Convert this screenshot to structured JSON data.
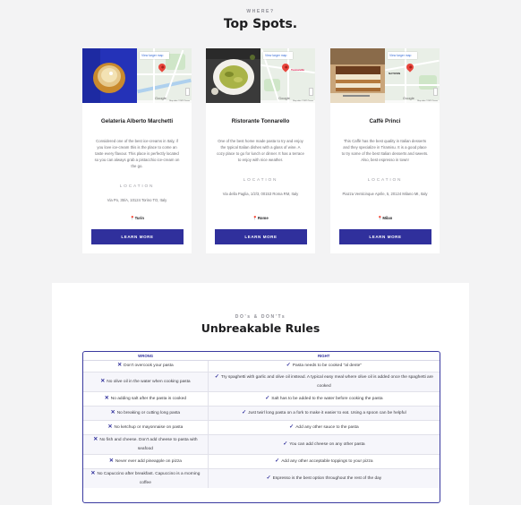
{
  "top_spots": {
    "eyebrow": "WHERE?",
    "title": "Top Spots.",
    "cards": [
      {
        "title": "Gelateria Alberto Marchetti",
        "desc": "Considered one of the best ice-creams in Italy, if you love ice-cream this is the place to come an taste every flavour. This place is perfectly located so you can always grab a pistacchio ice-cream on the go.",
        "location_label": "LOCATION",
        "address": "Via Po, 35/A, 10124 Torino TO, Italy",
        "city": "Turin",
        "button": "LEARN MORE",
        "map_link": "View larger map",
        "map_footer": "Map data ©2025  Terms",
        "map_brand": "Google"
      },
      {
        "title": "Ristorante Tonnarello",
        "desc": "One of the best home made pasta to try and enjoy the typical Italian dishes with a glass of wine. A cozy place to go for lunch or dinner. It has a terrace to enjoy with nice weather.",
        "location_label": "LOCATION",
        "address": "Via della Paglia, 1/2/3, 00153 Roma RM, Italy",
        "city": "Rome",
        "button": "LEARN MORE",
        "map_link": "View larger map",
        "map_footer": "Map data ©2025  Terms",
        "map_brand": "Google",
        "map_place": "Tonnarello"
      },
      {
        "title": "Caffè Princi",
        "desc": "This Caffè has the best quality in Italian desserts and they specialize in Tiramisu. It is a good place to try some of the best Italian desserts and sweets. Also, best espresso in town!",
        "location_label": "LOCATION",
        "address": "Piazza Venticinque Aprile, 5, 20124 Milano MI, Italy",
        "city": "Milan",
        "button": "LEARN MORE",
        "map_link": "View larger map",
        "map_footer": "Map data ©2025  Terms",
        "map_brand": "Google",
        "map_place": "NATOWN"
      }
    ]
  },
  "rules": {
    "eyebrow": "DO's & DON'Ts",
    "title": "Unbreakable Rules",
    "col_wrong": "WRONG",
    "col_right": "RIGHT",
    "rows": [
      {
        "wrong": "Don't overcook your pasta",
        "right": "Pasta needs to be cooked \"al dente\""
      },
      {
        "wrong": "No olive oil in the water when cooking pasta",
        "right": "Try spaghetti with garlic and olive oil instead. A typical easy meal where olive oil is added once the spaghetti are cooked"
      },
      {
        "wrong": "No adding salt after the pasta is cooked",
        "right": "Salt has to be added to the water before cooking the pasta"
      },
      {
        "wrong": "No breaking or cutting long pasta",
        "right": "Just twirl long pasta on a fork to make it easier to eat. Using a spoon can be helpful"
      },
      {
        "wrong": "No ketchup or mayonnaise on pasta",
        "right": "Add any other sauce to the pasta"
      },
      {
        "wrong": "No fish and cheese. Don't add cheese to pasta with seafood",
        "right": "You can add cheese on any other pasta"
      },
      {
        "wrong": "Never ever add pineapple on pizza",
        "right": "Add any other acceptable toppings to your pizza"
      },
      {
        "wrong": "No Capuccino after breakfast. Capuccino is a morning coffee",
        "right": "Espresso is the best option throughout the rest of the day"
      }
    ]
  },
  "colors": {
    "accent": "#30309c",
    "pin": "#e8453c",
    "background": "#f3f3f4"
  }
}
